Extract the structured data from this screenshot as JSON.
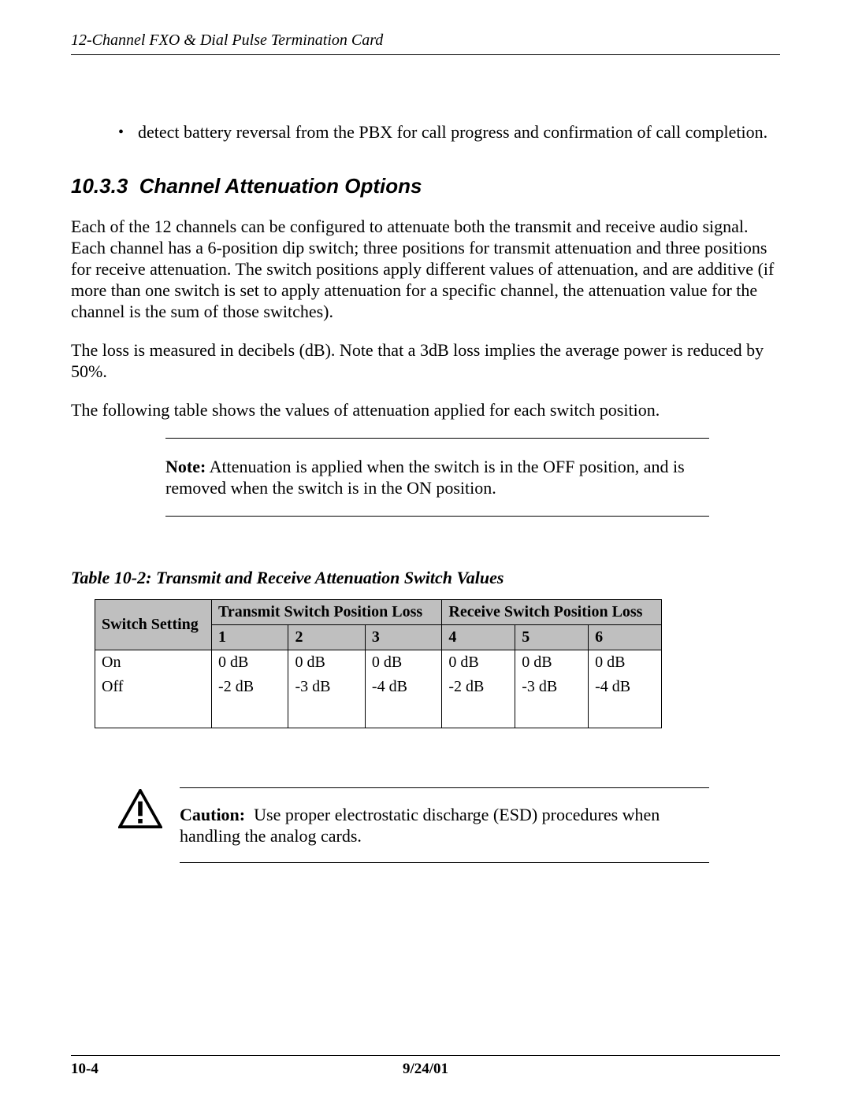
{
  "header": {
    "doc_title": "12-Channel FXO & Dial Pulse Termination Card"
  },
  "bullet": {
    "text": "detect battery reversal from the PBX for call progress and confirmation of call completion."
  },
  "section": {
    "number": "10.3.3",
    "title": "Channel Attenuation Options"
  },
  "paragraphs": {
    "p1": "Each of the 12 channels can be configured to attenuate both the transmit and receive audio signal. Each channel has a 6-position dip switch; three positions for transmit attenuation and three positions for receive attenuation. The switch positions apply different values of attenuation, and are additive (if more than one switch is set to apply attenuation for a specific channel, the attenuation value for the channel is the sum of those switches).",
    "p2": "The loss is measured in decibels (dB). Note that a 3dB loss implies the average power is reduced by 50%.",
    "p3": "The following table shows the values of attenuation applied for each switch position."
  },
  "note": {
    "label": "Note:",
    "text": "Attenuation is applied when the switch is in the OFF position, and is removed when the switch is in the ON position."
  },
  "table": {
    "caption": "Table 10-2: Transmit and Receive Attenuation Switch Values",
    "col_switch": "Switch Setting",
    "group_tx": "Transmit Switch Position Loss",
    "group_rx": "Receive Switch Position Loss",
    "cols": [
      "1",
      "2",
      "3",
      "4",
      "5",
      "6"
    ],
    "rows": [
      {
        "label": "On",
        "vals": [
          "0 dB",
          "0 dB",
          "0 dB",
          "0 dB",
          "0  dB",
          "0 dB"
        ]
      },
      {
        "label": "Off",
        "vals": [
          "-2 dB",
          "-3 dB",
          "-4 dB",
          "-2 dB",
          "-3 dB",
          "-4 dB"
        ]
      }
    ]
  },
  "caution": {
    "label": "Caution:",
    "text": "Use proper electrostatic discharge (ESD) procedures when handling the analog cards."
  },
  "footer": {
    "page": "10-4",
    "date": "9/24/01"
  },
  "chart_data": {
    "type": "table",
    "title": "Table 10-2: Transmit and Receive Attenuation Switch Values",
    "row_labels": [
      "On",
      "Off"
    ],
    "column_groups": [
      {
        "name": "Transmit Switch Position Loss",
        "columns": [
          "1",
          "2",
          "3"
        ]
      },
      {
        "name": "Receive Switch Position Loss",
        "columns": [
          "4",
          "5",
          "6"
        ]
      }
    ],
    "unit": "dB",
    "values": {
      "On": {
        "1": 0,
        "2": 0,
        "3": 0,
        "4": 0,
        "5": 0,
        "6": 0
      },
      "Off": {
        "1": -2,
        "2": -3,
        "3": -4,
        "4": -2,
        "5": -3,
        "6": -4
      }
    }
  }
}
